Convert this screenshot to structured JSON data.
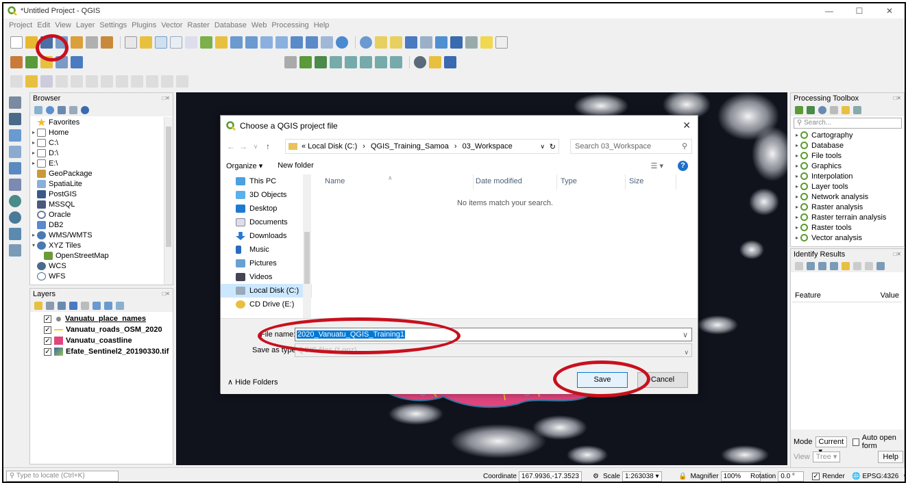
{
  "window": {
    "title": "*Untitled Project - QGIS",
    "controls": [
      "—",
      "☐",
      "✕"
    ]
  },
  "menu": [
    "Project",
    "Edit",
    "View",
    "Layer",
    "Settings",
    "Plugins",
    "Vector",
    "Raster",
    "Database",
    "Web",
    "Processing",
    "Help"
  ],
  "browser": {
    "title": "Browser",
    "items": [
      {
        "label": "Favorites",
        "icon": "star-icon",
        "expander": ""
      },
      {
        "label": "Home",
        "icon": "home-folder-icon",
        "expander": "▸"
      },
      {
        "label": "C:\\",
        "icon": "folder-icon",
        "expander": "▸"
      },
      {
        "label": "D:\\",
        "icon": "folder-icon",
        "expander": "▸"
      },
      {
        "label": "E:\\",
        "icon": "folder-icon",
        "expander": "▸"
      },
      {
        "label": "GeoPackage",
        "icon": "geopackage-icon",
        "expander": ""
      },
      {
        "label": "SpatiaLite",
        "icon": "spatialite-icon",
        "expander": ""
      },
      {
        "label": "PostGIS",
        "icon": "postgis-icon",
        "expander": ""
      },
      {
        "label": "MSSQL",
        "icon": "mssql-icon",
        "expander": ""
      },
      {
        "label": "Oracle",
        "icon": "oracle-icon",
        "expander": ""
      },
      {
        "label": "DB2",
        "icon": "db2-icon",
        "expander": ""
      },
      {
        "label": "WMS/WMTS",
        "icon": "wms-icon",
        "expander": "▸"
      },
      {
        "label": "XYZ Tiles",
        "icon": "xyz-icon",
        "expander": "▾"
      },
      {
        "label": "OpenStreetMap",
        "icon": "osm-icon",
        "expander": "",
        "indent": true
      },
      {
        "label": "WCS",
        "icon": "wcs-icon",
        "expander": ""
      },
      {
        "label": "WFS",
        "icon": "wfs-icon",
        "expander": ""
      }
    ]
  },
  "layers": {
    "title": "Layers",
    "items": [
      {
        "label": "Vanuatu_place_names",
        "checked": "✓",
        "underline": true
      },
      {
        "label": "Vanuatu_roads_OSM_2020",
        "checked": "✓"
      },
      {
        "label": "Vanuatu_coastline",
        "checked": "✓"
      },
      {
        "label": "Efate_Sentinel2_20190330.tif",
        "checked": "✓"
      }
    ]
  },
  "toolbox": {
    "title": "Processing Toolbox",
    "search_placeholder": "Search...",
    "items": [
      "Cartography",
      "Database",
      "File tools",
      "Graphics",
      "Interpolation",
      "Layer tools",
      "Network analysis",
      "Raster analysis",
      "Raster terrain analysis",
      "Raster tools",
      "Vector analysis"
    ]
  },
  "identify": {
    "title": "Identify Results",
    "col_feature": "Feature",
    "col_value": "Value",
    "mode_label": "Mode",
    "mode_value": "Current",
    "auto_open": "Auto open form",
    "view_label": "View",
    "view_value": "Tree",
    "help": "Help"
  },
  "status": {
    "locate_placeholder": "Type to locate (Ctrl+K)",
    "coordinate_label": "Coordinate",
    "coordinate_value": "167.9936,-17.3523",
    "scale_label": "Scale",
    "scale_value": "1:263038",
    "magnifier_label": "Magnifier",
    "magnifier_value": "100%",
    "rotation_label": "Rotation",
    "rotation_value": "0.0 °",
    "render_label": "Render",
    "crs": "EPSG:4326"
  },
  "dialog": {
    "title": "Choose a QGIS project file",
    "breadcrumbs": [
      "« Local Disk (C:)",
      "›",
      "QGIS_Training_Samoa",
      "›",
      "03_Workspace"
    ],
    "search_placeholder": "Search 03_Workspace",
    "organize": "Organize ▾",
    "new_folder": "New folder",
    "nav": [
      {
        "label": "This PC",
        "icon": "pc-icon"
      },
      {
        "label": "3D Objects",
        "icon": "3d-objects-icon"
      },
      {
        "label": "Desktop",
        "icon": "desktop-icon"
      },
      {
        "label": "Documents",
        "icon": "documents-icon"
      },
      {
        "label": "Downloads",
        "icon": "downloads-icon"
      },
      {
        "label": "Music",
        "icon": "music-icon"
      },
      {
        "label": "Pictures",
        "icon": "pictures-icon"
      },
      {
        "label": "Videos",
        "icon": "videos-icon"
      },
      {
        "label": "Local Disk (C:)",
        "icon": "local-disk-icon",
        "selected": true
      },
      {
        "label": "CD Drive (E:)",
        "icon": "cd-drive-icon"
      }
    ],
    "columns": [
      "Name",
      "Date modified",
      "Type",
      "Size"
    ],
    "empty_message": "No items match your search.",
    "filename_label": "File name:",
    "filename_value": "2020_Vanuatu_QGIS_Training1",
    "savetype_label": "Save as type:",
    "savetype_value": "QGIS files (*.qgz)",
    "hide_folders": "∧  Hide Folders",
    "save": "Save",
    "cancel": "Cancel"
  },
  "colors": {
    "annotation_red": "#c8101e",
    "qgis_green": "#5a9b2e",
    "selection_blue": "#0078d7",
    "coastline_pink": "#e0457e",
    "roads_yellow": "#f0d020"
  }
}
